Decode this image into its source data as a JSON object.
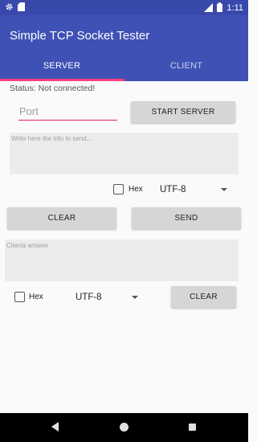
{
  "status_bar": {
    "time": "1:11",
    "icons": [
      "gear-icon",
      "sd-card-icon",
      "signal-icon",
      "battery-icon"
    ]
  },
  "app": {
    "title": "Simple TCP Socket Tester",
    "tabs": [
      {
        "label": "SERVER",
        "selected": true
      },
      {
        "label": "CLIENT",
        "selected": false
      }
    ]
  },
  "server": {
    "status": "Status: Not connected!",
    "port_placeholder": "Port",
    "start_button": "START SERVER",
    "message_placeholder": "Write here the info to send...",
    "send_options": {
      "hex_label": "Hex",
      "hex_checked": false,
      "encoding": "UTF-8"
    },
    "clear_button": "CLEAR",
    "send_button": "SEND",
    "answer_placeholder": "Clients answer",
    "answer_options": {
      "hex_label": "Hex",
      "hex_checked": false,
      "encoding": "UTF-8"
    },
    "answer_clear_button": "CLEAR"
  },
  "colors": {
    "primary": "#3f51b5",
    "primary_dark": "#3949ab",
    "accent": "#ff4081"
  }
}
